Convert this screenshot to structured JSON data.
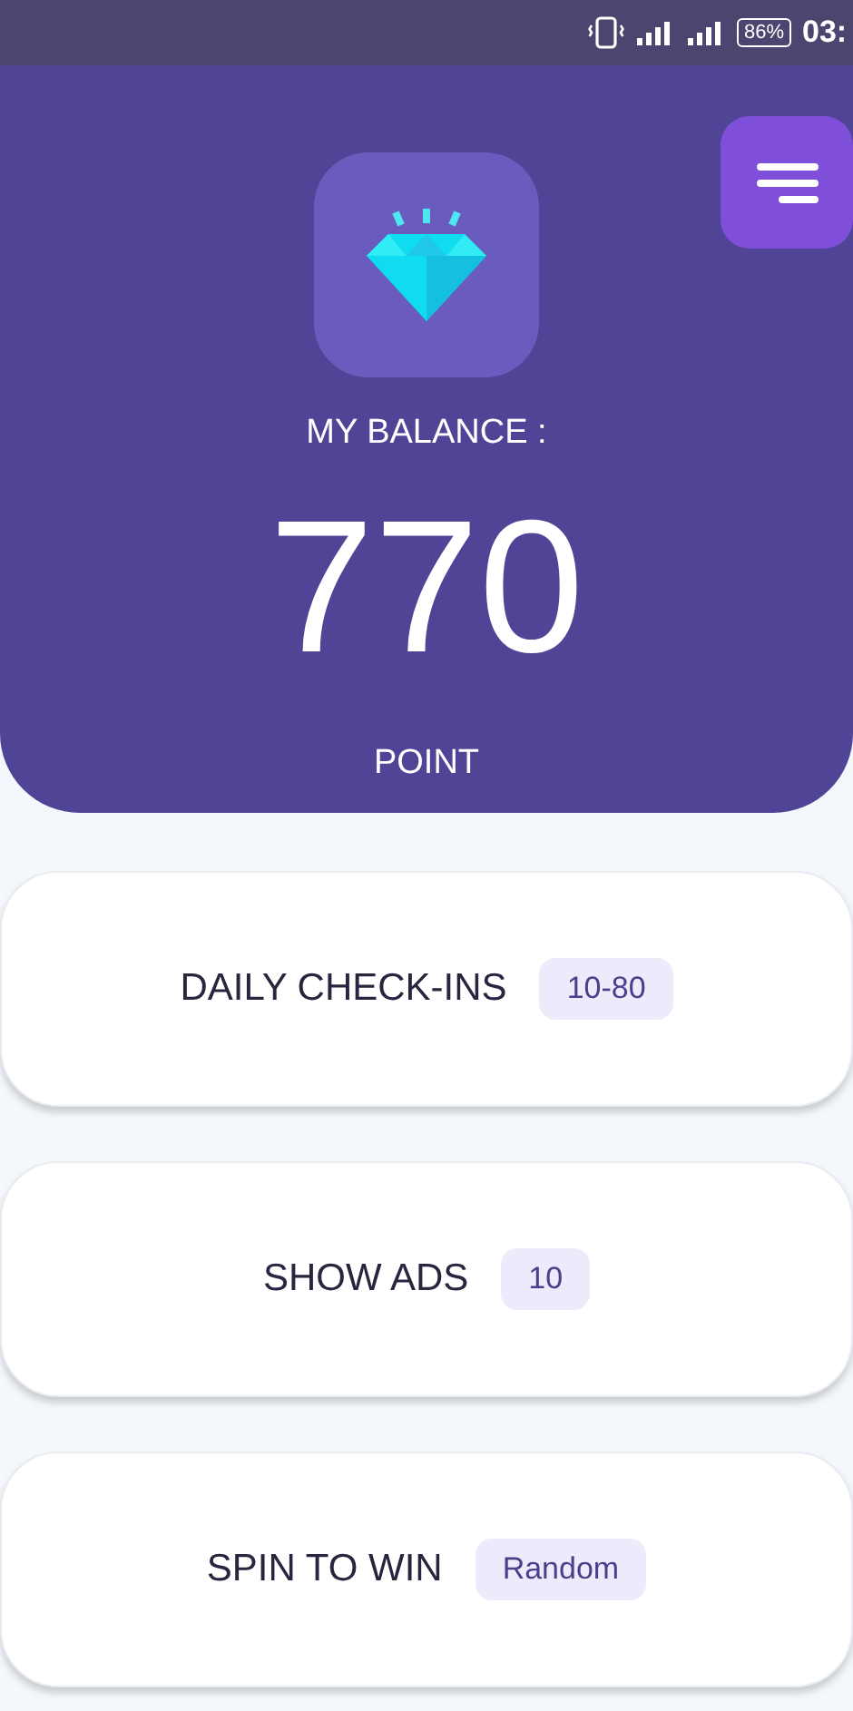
{
  "status_bar": {
    "battery": "86%",
    "time": "03:"
  },
  "balance": {
    "label": "MY BALANCE :",
    "value": "770",
    "unit": "POINT"
  },
  "tasks": [
    {
      "title": "DAILY CHECK-INS",
      "reward": "10-80"
    },
    {
      "title": "SHOW ADS",
      "reward": "10"
    },
    {
      "title": "SPIN TO WIN",
      "reward": "Random"
    }
  ]
}
